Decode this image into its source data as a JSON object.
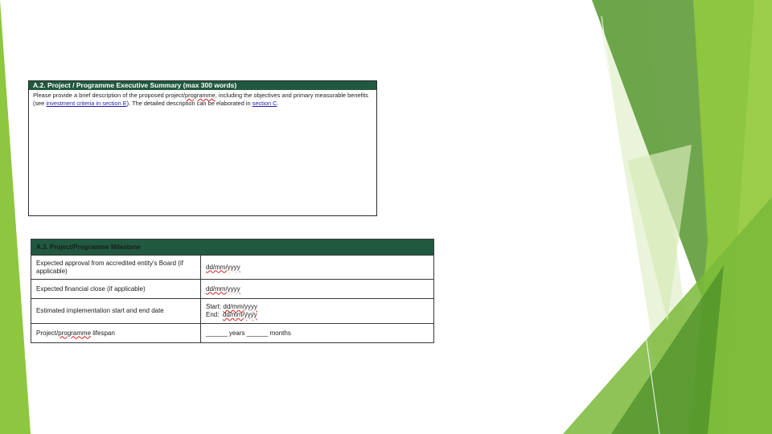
{
  "section_a2": {
    "header": "A.2. Project / Programme Executive Summary (max 300 words)",
    "desc_part1": "Please provide a brief description of the proposed project/",
    "desc_squiggle": "programme",
    "desc_part2": ", including the objectives and primary measurable benefits (see ",
    "desc_link1": "investment criteria in section E",
    "desc_part3": "). The detailed description can be elaborated in ",
    "desc_link2": "section C",
    "desc_part4": "."
  },
  "section_a3": {
    "header": "A.3. Project/Programme Milestone",
    "rows": [
      {
        "label": "Expected approval from accredited entity's Board (if applicable)",
        "value": "dd/mm/yyyy"
      },
      {
        "label": "Expected financial close (if applicable)",
        "value": "dd/mm/yyyy"
      },
      {
        "label": "Estimated implementation start and end date",
        "start_prefix": "Start: ",
        "start_value": "dd/mm/yyyy",
        "end_prefix": "End:  ",
        "end_value": "dd/mm/yyyy"
      },
      {
        "label_part1": "Project/",
        "label_squiggle": "programme",
        "label_part2": " lifespan",
        "value": "______ years ______ months"
      }
    ]
  },
  "colors": {
    "header_green": "#20593f",
    "accent_light": "#8dc63f",
    "accent_dark": "#4a8a2a",
    "link_blue": "#1f1fb0"
  }
}
